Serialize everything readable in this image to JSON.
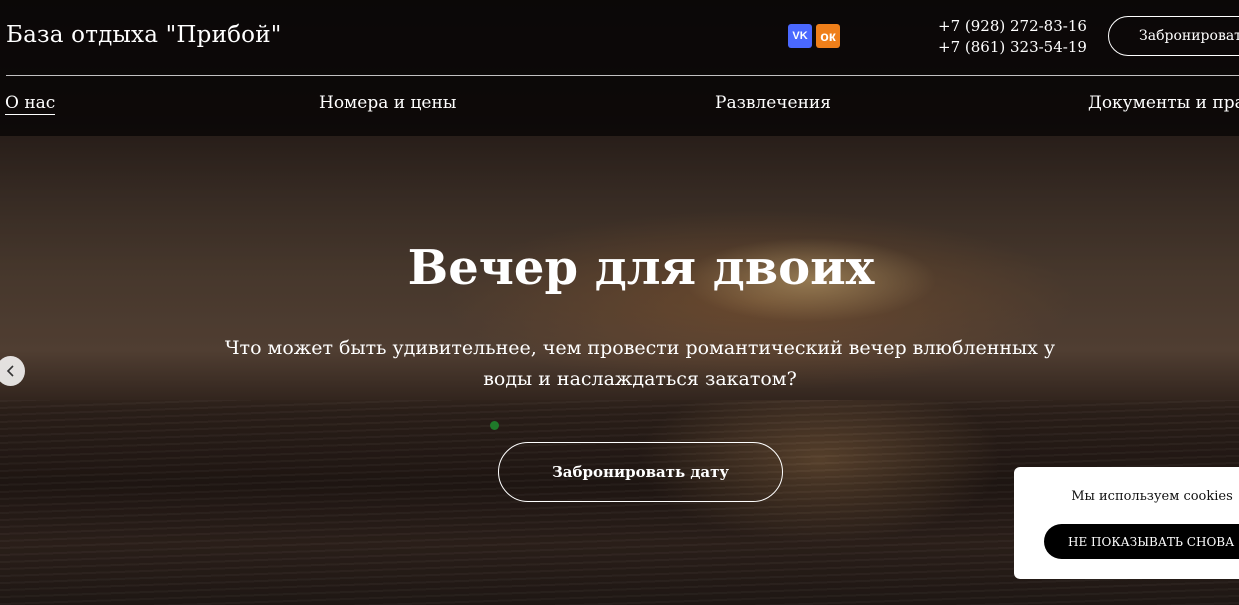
{
  "header": {
    "brand": "База отдыха \"Прибой\"",
    "socials": [
      {
        "name": "vk",
        "label": "VK",
        "color": "#4a68ff"
      },
      {
        "name": "ok",
        "label": "ок",
        "color": "#ef7f1a"
      }
    ],
    "phones": [
      "+7 (928) 272-83-16",
      "+7 (861) 323-54-19"
    ],
    "book_button": "Забронировать"
  },
  "nav": {
    "items": [
      {
        "label": "О нас",
        "active": true
      },
      {
        "label": "Номера и цены",
        "active": false
      },
      {
        "label": "Развлечения",
        "active": false
      },
      {
        "label": "Документы и правила",
        "active": false
      }
    ]
  },
  "hero": {
    "title": "Вечер для двоих",
    "text": "Что может быть удивительнее, чем провести романтический вечер влюбленных у воды и наслаждаться закатом?",
    "cta": "Забронировать дату",
    "prev_icon": "chevron-left-icon"
  },
  "cookie": {
    "text": "Мы используем cookies",
    "button": "НЕ ПОКАЗЫВАТЬ СНОВА"
  }
}
